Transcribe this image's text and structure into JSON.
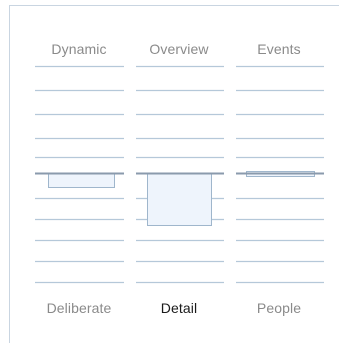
{
  "columns": [
    {
      "id": "left",
      "top_label": "Dynamic",
      "bottom_label": "Deliberate",
      "bottom_emphasized": false,
      "selector_style": "shallow-tray"
    },
    {
      "id": "middle",
      "top_label": "Overview",
      "bottom_label": "Detail",
      "bottom_emphasized": true,
      "selector_style": "deep-box"
    },
    {
      "id": "right",
      "top_label": "Events",
      "bottom_label": "People",
      "bottom_emphasized": false,
      "selector_style": "flat-bar"
    }
  ],
  "colors": {
    "label_muted": "#8a8a8a",
    "label_emphasis": "#1a1a1a",
    "line": "#b5c8d9",
    "divider": "#8a9aac",
    "highlight_fill": "#eef4fc",
    "highlight_stroke": "#9fb6cc",
    "border": "#c9d5e1"
  }
}
